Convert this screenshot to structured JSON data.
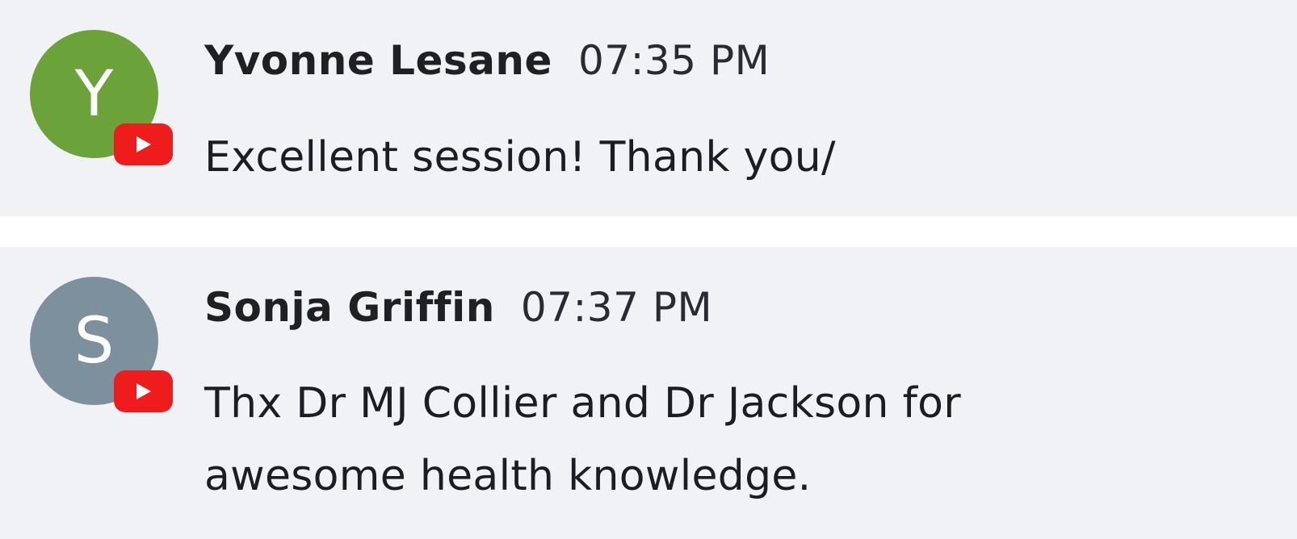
{
  "colors": {
    "message_background": "#f1f2f5",
    "separator": "#ffffff",
    "youtube_red": "#ee1c1c"
  },
  "messages": [
    {
      "avatar_letter": "Y",
      "avatar_color": "#6ba23a",
      "author": "Yvonne Lesane",
      "time": "07:35 PM",
      "text": "Excellent session! Thank you/",
      "platform_icon": "youtube-icon"
    },
    {
      "avatar_letter": "S",
      "avatar_color": "#7d909e",
      "author": "Sonja Griffin",
      "time": "07:37 PM",
      "text": "Thx Dr MJ Collier and Dr Jackson for awesome health knowledge.",
      "platform_icon": "youtube-icon"
    }
  ]
}
